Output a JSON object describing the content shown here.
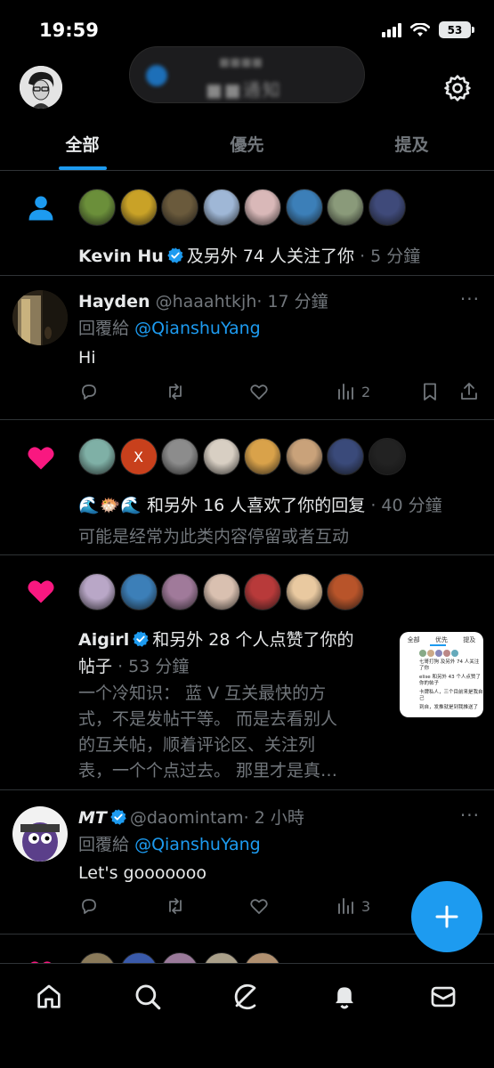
{
  "status_bar": {
    "time": "19:59",
    "battery": "53"
  },
  "island": {
    "title": "■■■■",
    "subtitle": "■■通知"
  },
  "tabs": [
    {
      "label": "全部",
      "active": true
    },
    {
      "label": "優先",
      "active": false
    },
    {
      "label": "提及",
      "active": false
    }
  ],
  "notifications": {
    "follow": {
      "name": "Kevin Hu",
      "text": "及另外 74 人关注了你",
      "time": "· 5 分鐘",
      "avatar_colors": [
        "#6b8f3a",
        "#c9a227",
        "#6a5a3c",
        "#9fb7d6",
        "#d9b8b8",
        "#3c7fb8",
        "#8a9a7a",
        "#3f4a7a"
      ]
    },
    "reply_hayden": {
      "name": "Hayden",
      "handle": "@haaahtkjh",
      "time": "· 17 分鐘",
      "reply_prefix": "回覆給",
      "reply_to": "@QianshuYang",
      "body": "Hi",
      "views": "2",
      "more": "···"
    },
    "like_reply": {
      "emojis": "🌊🐡🌊",
      "text": "和另外 16 人喜欢了你的回复",
      "time": "· 40 分鐘",
      "note": "可能是经常为此类内容停留或者互动",
      "x_letter": "X",
      "avatar_colors": [
        "#7fb0a6",
        "#c8401c",
        "#8c8c8c",
        "#d8cfc3",
        "#d9a24a",
        "#c9a27a",
        "#3a4a7a",
        "#222222"
      ]
    },
    "like_post": {
      "name": "Aigirl",
      "text": "和另外 28 个人点赞了你的",
      "text2": "帖子",
      "time": "· 53 分鐘",
      "body_lines": [
        "一个冷知识： 蓝 V 互关最快的方",
        "式，不是发帖干等。 而是去看别人",
        "的互关帖，顺着评论区、关注列",
        "表，一个个点过去。 那里才是真…"
      ],
      "thumb_tabs": [
        "全部",
        "优先",
        "提及"
      ],
      "thumb_lines": [
        "七哥打狗 及另外 74 人关注了你",
        "elise 和另外 43 个人点赞了你的帖子",
        "卡牌私人，三个目前来是我自己",
        "到自，发推就是到我推送了"
      ],
      "avatar_colors": [
        "#b9a7c7",
        "#3c7fb8",
        "#a07a9a",
        "#d9c0b0",
        "#b83a3a",
        "#e9c9a0",
        "#b8542a"
      ]
    },
    "reply_mt": {
      "name": "MT",
      "handle": "@daomintam",
      "time": "· 2 小時",
      "reply_prefix": "回覆給",
      "reply_to": "@QianshuYang",
      "body": "Let's gooooooo",
      "views": "3",
      "more": "···"
    }
  },
  "colors": {
    "accent": "#1d9bf0",
    "like": "#f91880",
    "muted": "#71767b",
    "background": "#000000"
  }
}
